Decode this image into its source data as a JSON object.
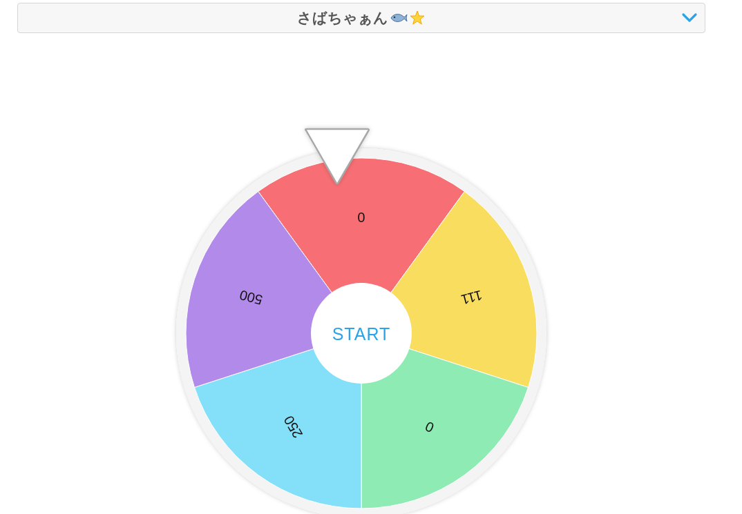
{
  "selector": {
    "title": "さばちゃぁん"
  },
  "wheel": {
    "segments": [
      {
        "label": "0",
        "color": "#f76f74"
      },
      {
        "label": "111",
        "color": "#f9dd5f"
      },
      {
        "label": "0",
        "color": "#8eebb3"
      },
      {
        "label": "250",
        "color": "#84e0f9"
      },
      {
        "label": "500",
        "color": "#b18aea"
      }
    ],
    "button": "START"
  }
}
